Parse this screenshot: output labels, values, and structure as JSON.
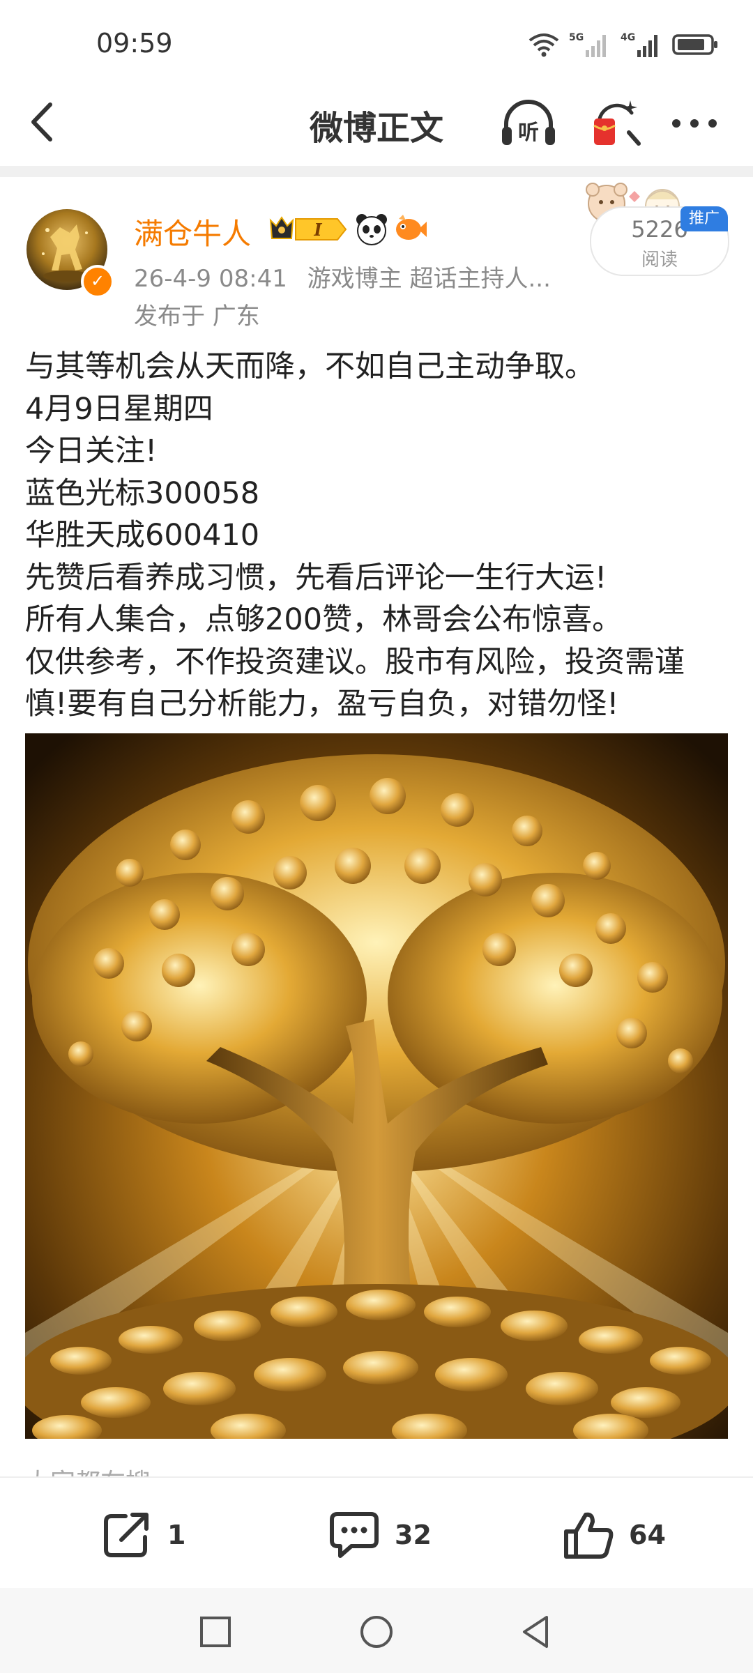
{
  "status_bar": {
    "time": "09:59",
    "icons": [
      "wifi-icon",
      "signal-5g-icon",
      "signal-4g-icon",
      "battery-icon"
    ],
    "network_labels": [
      "5G",
      "4G"
    ]
  },
  "nav": {
    "title": "微博正文",
    "listen_label": "听"
  },
  "post": {
    "author": "满仓牛人",
    "vip_level": "I",
    "timestamp": "26-4-9 08:41",
    "tags": "游戏博主 超话主持人...",
    "location": "发布于 广东",
    "reads": "5226",
    "reads_label": "阅读",
    "promo_label": "推广",
    "lines": [
      "与其等机会从天而降，不如自己主动争取。",
      "4月9日星期四",
      "今日关注!",
      "蓝色光标300058",
      "华胜天成600410",
      "先赞后看养成习惯，先看后评论一生行大运!",
      "所有人集合，点够200赞，林哥会公布惊喜。",
      "仅供参考，不作投资建议。股市有风险，投资需谨",
      "慎!要有自己分析能力，盈亏自负，对错勿怪!"
    ],
    "peek_text": "大家都在搜"
  },
  "actions": {
    "share_count": "1",
    "comment_count": "32",
    "like_count": "64"
  },
  "colors": {
    "username": "#f57b00",
    "promo": "#2f7de1",
    "accent_badge": "#ff8200"
  }
}
